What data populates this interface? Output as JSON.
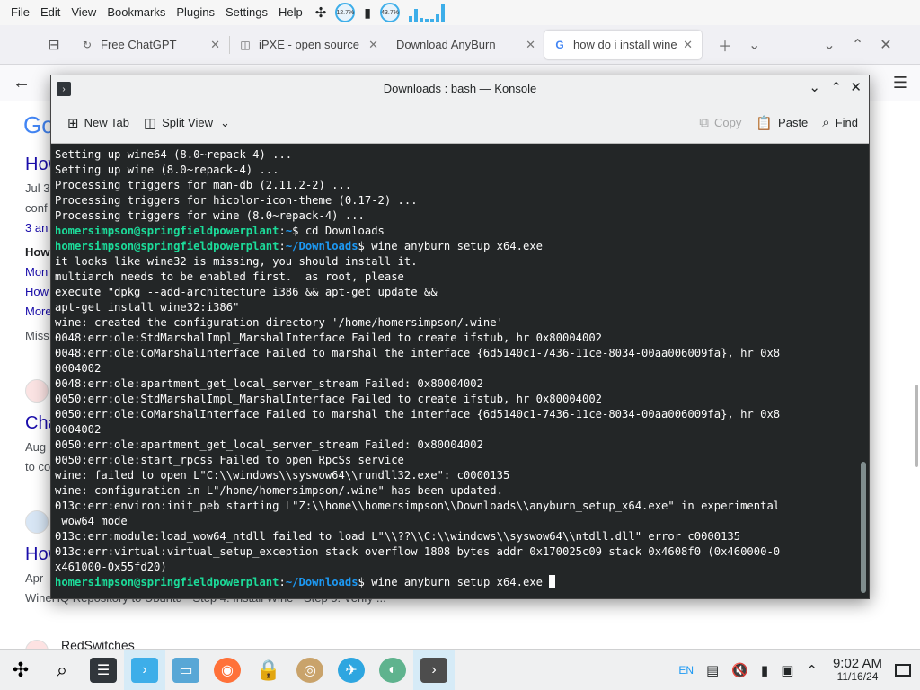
{
  "menubar": {
    "items": [
      "File",
      "Edit",
      "View",
      "Bookmarks",
      "Plugins",
      "Settings",
      "Help"
    ],
    "cpu_label": "12.7%",
    "mem_label": "43.7%"
  },
  "browser": {
    "tabs": [
      {
        "label": "Free ChatGPT"
      },
      {
        "label": "iPXE - open source"
      },
      {
        "label": "Download AnyBurn"
      },
      {
        "label": "how do i install wine"
      }
    ],
    "page": {
      "logo": "Go",
      "result1_title": "How",
      "result1_date": "Jul 3",
      "result1_snip": "conf",
      "result1_answers": "3 an",
      "sub1": "How",
      "sub2": "Mon",
      "sub3": "How",
      "sub4": "More",
      "missing": "Miss",
      "result2_title": "Cha",
      "result2_date": "Aug",
      "result2_snip": "to co",
      "result3_title": "How",
      "result3_date": "Apr",
      "result3_snip": "WineHQ Repository to Ubuntu · Step 4: Install Wine · Step 5: Verify ...",
      "result4_site": "RedSwitches"
    }
  },
  "konsole": {
    "title": "Downloads : bash — Konsole",
    "toolbar": {
      "new_tab": "New Tab",
      "split_view": "Split View",
      "copy": "Copy",
      "paste": "Paste",
      "find": "Find"
    },
    "lines": [
      {
        "text": "Setting up wine64 (8.0~repack-4) ..."
      },
      {
        "text": "Setting up wine (8.0~repack-4) ..."
      },
      {
        "text": "Processing triggers for man-db (2.11.2-2) ..."
      },
      {
        "text": "Processing triggers for hicolor-icon-theme (0.17-2) ..."
      },
      {
        "text": "Processing triggers for wine (8.0~repack-4) ..."
      },
      {
        "user": "homersimpson@springfieldpowerplant",
        "path": "~",
        "cmd": "$ cd Downloads"
      },
      {
        "user": "homersimpson@springfieldpowerplant",
        "path": "~/Downloads",
        "cmd": "$ wine anyburn_setup_x64.exe"
      },
      {
        "text": "it looks like wine32 is missing, you should install it."
      },
      {
        "text": "multiarch needs to be enabled first.  as root, please"
      },
      {
        "text": "execute \"dpkg --add-architecture i386 && apt-get update &&"
      },
      {
        "text": "apt-get install wine32:i386\""
      },
      {
        "text": "wine: created the configuration directory '/home/homersimpson/.wine'"
      },
      {
        "text": "0048:err:ole:StdMarshalImpl_MarshalInterface Failed to create ifstub, hr 0x80004002"
      },
      {
        "text": "0048:err:ole:CoMarshalInterface Failed to marshal the interface {6d5140c1-7436-11ce-8034-00aa006009fa}, hr 0x8"
      },
      {
        "text": "0004002"
      },
      {
        "text": "0048:err:ole:apartment_get_local_server_stream Failed: 0x80004002"
      },
      {
        "text": "0050:err:ole:StdMarshalImpl_MarshalInterface Failed to create ifstub, hr 0x80004002"
      },
      {
        "text": "0050:err:ole:CoMarshalInterface Failed to marshal the interface {6d5140c1-7436-11ce-8034-00aa006009fa}, hr 0x8"
      },
      {
        "text": "0004002"
      },
      {
        "text": "0050:err:ole:apartment_get_local_server_stream Failed: 0x80004002"
      },
      {
        "text": "0050:err:ole:start_rpcss Failed to open RpcSs service"
      },
      {
        "text": "wine: failed to open L\"C:\\\\windows\\\\syswow64\\\\rundll32.exe\": c0000135"
      },
      {
        "text": "wine: configuration in L\"/home/homersimpson/.wine\" has been updated."
      },
      {
        "text": "013c:err:environ:init_peb starting L\"Z:\\\\home\\\\homersimpson\\\\Downloads\\\\anyburn_setup_x64.exe\" in experimental"
      },
      {
        "text": " wow64 mode"
      },
      {
        "text": "013c:err:module:load_wow64_ntdll failed to load L\"\\\\??\\\\C:\\\\windows\\\\syswow64\\\\ntdll.dll\" error c0000135"
      },
      {
        "text": "013c:err:virtual:virtual_setup_exception stack overflow 1808 bytes addr 0x170025c09 stack 0x4608f0 (0x460000-0"
      },
      {
        "text": "x461000-0x55fd20)"
      },
      {
        "user": "homersimpson@springfieldpowerplant",
        "path": "~/Downloads",
        "cmd": "$ wine anyburn_setup_x64.exe ",
        "cursor": true
      }
    ]
  },
  "taskbar": {
    "lang": "EN",
    "time": "9:02 AM",
    "date": "11/16/24"
  }
}
